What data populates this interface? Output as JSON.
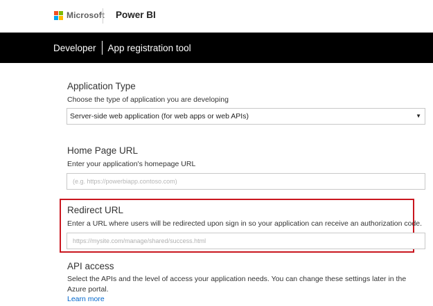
{
  "header": {
    "brand": "Microsoft",
    "product": "Power BI",
    "logo_colors": [
      "#f25022",
      "#7fba00",
      "#00a4ef",
      "#ffb900"
    ]
  },
  "subheader": {
    "section": "Developer",
    "tool": "App registration tool"
  },
  "application_type": {
    "title": "Application Type",
    "description": "Choose the type of application you are developing",
    "selected": "Server-side web application (for web apps or web APIs)"
  },
  "home_page_url": {
    "title": "Home Page URL",
    "description": "Enter your application's homepage URL",
    "placeholder": "(e.g. https://powerbiapp.contoso.com)"
  },
  "redirect_url": {
    "title": "Redirect URL",
    "description": "Enter a URL where users will be redirected upon sign in so your application can receive an authorization code.",
    "placeholder": "https://mysite.com/manage/shared/success.html",
    "highlight_color": "#c9151e"
  },
  "api_access": {
    "title": "API access",
    "description": "Select the APIs and the level of access your application needs. You can change these settings later in the Azure portal.",
    "learn_more": "Learn more"
  }
}
